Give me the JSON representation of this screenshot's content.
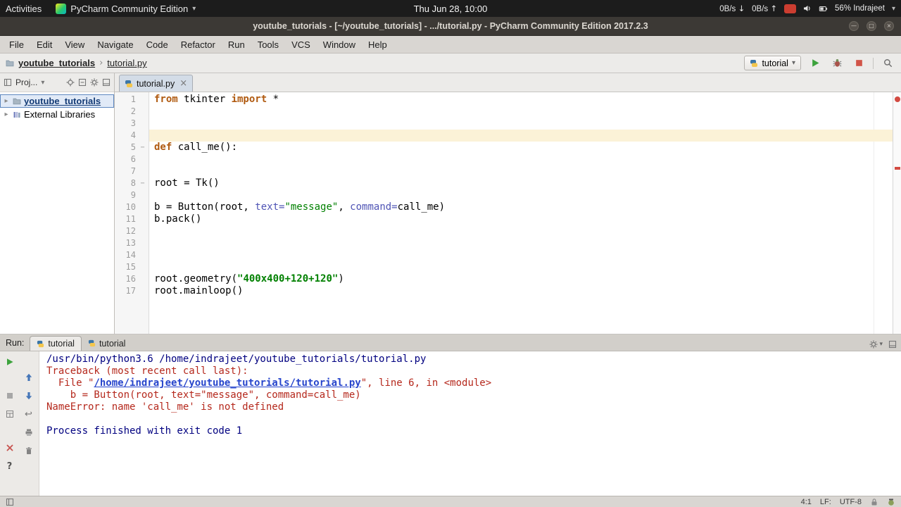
{
  "colors": {
    "keyword": "#b05a10",
    "string": "#008000",
    "param": "#4f54b5",
    "system": "#000080",
    "error": "#b5281c",
    "link": "#2745cc",
    "run_green": "#3da33d",
    "stop_red": "#d15448",
    "caret_line": "#fbf2d7",
    "selection": "#e1eaf7",
    "selection_border": "#5d87bf"
  },
  "icons": {
    "dropdown": "▾",
    "breadcrumb_separator": "›",
    "expand_arrow": "▸",
    "close": "×",
    "soft_wrap": "↩",
    "help": "?",
    "fold": "−",
    "net_down_arrow": "↓",
    "net_up_arrow": "↑",
    "minimize": "—",
    "maximize": "□",
    "window_close": "×"
  },
  "desktop_bar": {
    "activities_label": "Activities",
    "app_menu_label": "PyCharm Community Edition",
    "clock": "Thu Jun 28, 10:00",
    "net_down": "0B/s",
    "net_up": "0B/s",
    "battery_label": "56% Indrajeet"
  },
  "title_bar": {
    "title": "youtube_tutorials - [~/youtube_tutorials] - .../tutorial.py - PyCharm Community Edition 2017.2.3"
  },
  "menu_bar": {
    "items": [
      "File",
      "Edit",
      "View",
      "Navigate",
      "Code",
      "Refactor",
      "Run",
      "Tools",
      "VCS",
      "Window",
      "Help"
    ]
  },
  "nav_bar": {
    "crumb_project": "youtube_tutorials",
    "crumb_file": "tutorial.py",
    "run_config": "tutorial"
  },
  "project_panel": {
    "header": "Proj...",
    "root_item": "youtube_tutorials",
    "libraries_item": "External Libraries"
  },
  "editor": {
    "tab_label": "tutorial.py",
    "caret_line": 4,
    "fold_lines": [
      5,
      8
    ],
    "lines": [
      {
        "n": 1,
        "tokens": [
          [
            "from",
            "kw"
          ],
          [
            " tkinter ",
            ""
          ],
          [
            "import",
            "kw"
          ],
          [
            " *",
            ""
          ]
        ]
      },
      {
        "n": 2,
        "tokens": []
      },
      {
        "n": 3,
        "tokens": []
      },
      {
        "n": 4,
        "tokens": []
      },
      {
        "n": 5,
        "tokens": [
          [
            "def ",
            "kw"
          ],
          [
            "call_me():",
            ""
          ]
        ]
      },
      {
        "n": 6,
        "tokens": []
      },
      {
        "n": 7,
        "tokens": []
      },
      {
        "n": 8,
        "tokens": [
          [
            "root = Tk()",
            ""
          ]
        ]
      },
      {
        "n": 9,
        "tokens": []
      },
      {
        "n": 10,
        "tokens": [
          [
            "b = Button(root, ",
            ""
          ],
          [
            "text=",
            "param"
          ],
          [
            "\"message\"",
            "str"
          ],
          [
            ", ",
            ""
          ],
          [
            "command=",
            "param"
          ],
          [
            "call_me)",
            ""
          ]
        ]
      },
      {
        "n": 11,
        "tokens": [
          [
            "b.pack()",
            ""
          ]
        ]
      },
      {
        "n": 12,
        "tokens": []
      },
      {
        "n": 13,
        "tokens": []
      },
      {
        "n": 14,
        "tokens": []
      },
      {
        "n": 15,
        "tokens": []
      },
      {
        "n": 16,
        "tokens": [
          [
            "root.geometry(",
            ""
          ],
          [
            "\"400x400+120+120\"",
            "strb"
          ],
          [
            ")",
            ""
          ]
        ]
      },
      {
        "n": 17,
        "tokens": [
          [
            "root.mainloop()",
            ""
          ]
        ]
      }
    ]
  },
  "run_panel": {
    "label": "Run:",
    "tabs": [
      {
        "label": "tutorial"
      },
      {
        "label": "tutorial"
      }
    ],
    "console": [
      {
        "segs": [
          [
            "/usr/bin/python3.6 /home/indrajeet/youtube_tutorials/tutorial.py",
            "sys"
          ]
        ]
      },
      {
        "segs": [
          [
            "Traceback (most recent call last):",
            "err"
          ]
        ]
      },
      {
        "segs": [
          [
            "  File \"",
            "err"
          ],
          [
            "/home/indrajeet/youtube_tutorials/tutorial.py",
            "link"
          ],
          [
            "\", line 6, in <module>",
            "err"
          ]
        ]
      },
      {
        "segs": [
          [
            "    b = Button(root, text=\"message\", command=call_me)",
            "err"
          ]
        ]
      },
      {
        "segs": [
          [
            "NameError: name 'call_me' is not defined",
            "err"
          ]
        ]
      },
      {
        "segs": []
      },
      {
        "segs": [
          [
            "Process finished with exit code 1",
            "sys"
          ]
        ]
      }
    ]
  },
  "status_bar": {
    "position": "4:1",
    "line_separator": "LF:",
    "encoding": "UTF-8"
  }
}
